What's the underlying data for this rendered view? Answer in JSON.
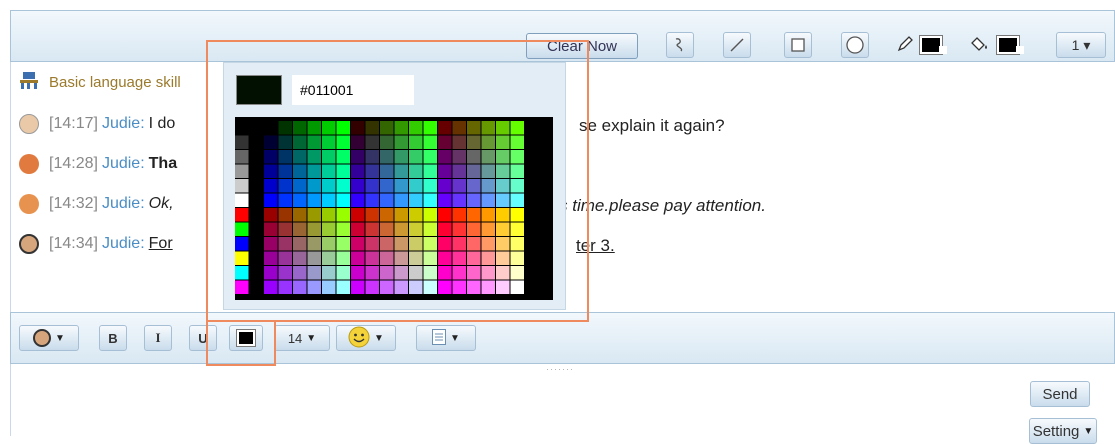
{
  "toolbar": {
    "clear_label": "Clear Now",
    "size_value": "1 ▾"
  },
  "chat": {
    "system_text": "Basic language skill",
    "messages": [
      {
        "time": "[14:17]",
        "user": "Judie:",
        "text": "I do",
        "tail": "se explain it again?"
      },
      {
        "time": "[14:28]",
        "user": "Judie:",
        "text": "Tha",
        "tail": ""
      },
      {
        "time": "[14:32]",
        "user": "Judie:",
        "text": "Ok,",
        "tail": "s time.please pay attention."
      },
      {
        "time": "[14:34]",
        "user": "Judie:",
        "text": "For",
        "tail": "ter 3."
      }
    ]
  },
  "format": {
    "bold": "B",
    "italic": "I",
    "underline": "U",
    "font_size": "14"
  },
  "input": {
    "send_label": "Send",
    "setting_label": "Setting"
  },
  "picker": {
    "hex_value": "#011001",
    "selected_color": "#011001"
  },
  "colors": {
    "accent": "#4b8dc5",
    "highlight": "#ef8a5e",
    "toolbar_bg": "#d9e8f3"
  }
}
